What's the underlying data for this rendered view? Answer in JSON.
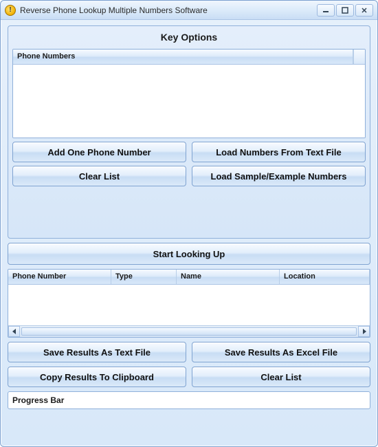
{
  "window": {
    "title": "Reverse Phone Lookup Multiple Numbers Software"
  },
  "group": {
    "title": "Key Options"
  },
  "input_list": {
    "header": "Phone Numbers"
  },
  "buttons": {
    "add_one": "Add One Phone Number",
    "load_file": "Load Numbers From Text File",
    "clear_input": "Clear List",
    "load_sample": "Load Sample/Example Numbers",
    "start": "Start Looking Up",
    "save_text": "Save Results As Text File",
    "save_excel": "Save Results As Excel File",
    "copy_clip": "Copy Results To Clipboard",
    "clear_results": "Clear List"
  },
  "results": {
    "columns": [
      "Phone Number",
      "Type",
      "Name",
      "Location"
    ]
  },
  "progress": {
    "label": "Progress Bar"
  }
}
